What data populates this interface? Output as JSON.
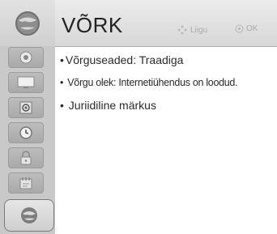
{
  "header": {
    "title": "VÕRK",
    "hint_move": "Liigu",
    "hint_ok": "OK"
  },
  "sidebar": {
    "items": [
      {
        "icon": "picture-icon"
      },
      {
        "icon": "screen-icon"
      },
      {
        "icon": "speaker-icon"
      },
      {
        "icon": "clock-icon"
      },
      {
        "icon": "lock-icon"
      },
      {
        "icon": "option-icon"
      },
      {
        "icon": "network-icon"
      }
    ]
  },
  "menu": {
    "items": [
      {
        "label": "Võrguseaded: Traadiga"
      },
      {
        "label": "Võrgu olek: Internetiühendus on loodud."
      },
      {
        "label": "Juriidiline märkus"
      }
    ]
  }
}
